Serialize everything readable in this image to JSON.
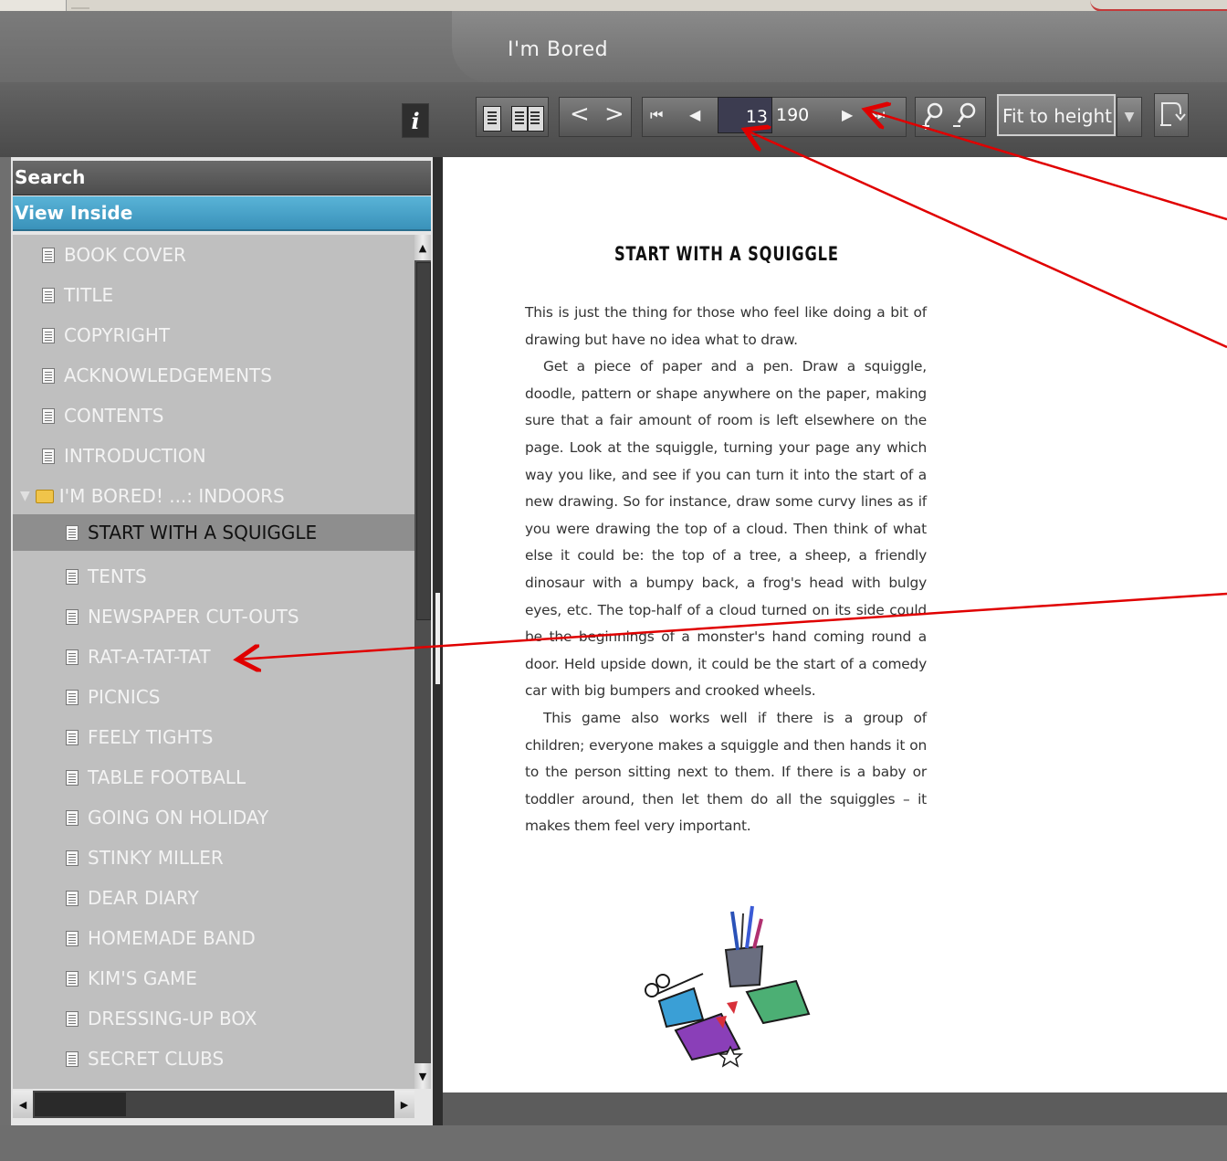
{
  "window": {
    "title": "I'm Bored"
  },
  "toolbar": {
    "info_label": "i",
    "page_current": "13",
    "page_total": "190",
    "fit_mode": "Fit to height",
    "prev_chevron": "<",
    "next_chevron": ">",
    "first_glyph": "⏮",
    "prev_glyph": "◀",
    "next_glyph": "▶",
    "last_glyph": "⏭",
    "zoom_in_glyph": "🔍",
    "zoom_out_glyph": "🔍"
  },
  "sidebar": {
    "search_label": "Search",
    "view_inside_label": "View Inside",
    "items": [
      {
        "label": "BOOK COVER",
        "level": 0,
        "type": "page"
      },
      {
        "label": "TITLE",
        "level": 0,
        "type": "page"
      },
      {
        "label": "COPYRIGHT",
        "level": 0,
        "type": "page"
      },
      {
        "label": "ACKNOWLEDGEMENTS",
        "level": 0,
        "type": "page"
      },
      {
        "label": "CONTENTS",
        "level": 0,
        "type": "page"
      },
      {
        "label": "INTRODUCTION",
        "level": 0,
        "type": "page"
      },
      {
        "label": "I'M BORED! ...: INDOORS",
        "level": 0,
        "type": "folder"
      },
      {
        "label": "START WITH A SQUIGGLE",
        "level": 1,
        "type": "page",
        "selected": true
      },
      {
        "label": "TENTS",
        "level": 1,
        "type": "page"
      },
      {
        "label": "NEWSPAPER CUT-OUTS",
        "level": 1,
        "type": "page"
      },
      {
        "label": "RAT-A-TAT-TAT",
        "level": 1,
        "type": "page"
      },
      {
        "label": "PICNICS",
        "level": 1,
        "type": "page"
      },
      {
        "label": "FEELY TIGHTS",
        "level": 1,
        "type": "page"
      },
      {
        "label": "TABLE FOOTBALL",
        "level": 1,
        "type": "page"
      },
      {
        "label": "GOING ON HOLIDAY",
        "level": 1,
        "type": "page"
      },
      {
        "label": "STINKY MILLER",
        "level": 1,
        "type": "page"
      },
      {
        "label": "DEAR DIARY",
        "level": 1,
        "type": "page"
      },
      {
        "label": "HOMEMADE BAND",
        "level": 1,
        "type": "page"
      },
      {
        "label": "KIM'S GAME",
        "level": 1,
        "type": "page"
      },
      {
        "label": "DRESSING-UP BOX",
        "level": 1,
        "type": "page"
      },
      {
        "label": "SECRET CLUBS",
        "level": 1,
        "type": "page"
      }
    ]
  },
  "document": {
    "heading": "START WITH A SQUIGGLE",
    "paragraphs": [
      "This is just the thing for those who feel like doing a bit of drawing but have no idea what to draw.",
      "Get a piece of paper and a pen. Draw a squiggle, doodle, pattern or shape anywhere on the paper, making sure that a fair amount of room is left elsewhere on the page. Look at the squiggle, turning your page any which way you like, and see if you can turn it into the start of a new drawing. So for instance, draw some curvy lines as if you were drawing the top of a cloud. Then think of what else it could be: the top of a tree, a sheep, a friendly dinosaur with a bumpy back, a frog's head with bulgy eyes, etc. The top-half of a cloud turned on its side could be the beginnings of a monster's hand coming round a door. Held upside down, it could be the start of a comedy car with big bumpers and crooked wheels.",
      "This game also works well if there is a group of children; everyone makes a squiggle and then hands it on to the person sitting next to them. If there is a baby or toddler around, then let them do all the squiggles – it makes them feel very important."
    ]
  },
  "colors": {
    "accent": "#3a92ba",
    "annotation": "#e00000",
    "selected_row": "#8e8e8e"
  }
}
